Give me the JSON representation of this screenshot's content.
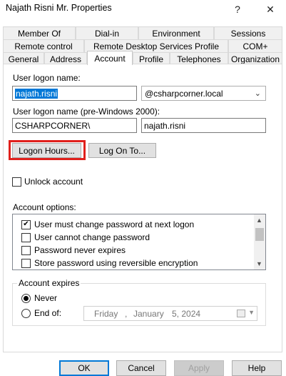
{
  "window": {
    "title": "Najath Risni Mr. Properties",
    "help_glyph": "?",
    "close_glyph": "✕"
  },
  "tabs": {
    "row1": [
      "Member Of",
      "Dial-in",
      "Environment",
      "Sessions"
    ],
    "row2": [
      "Remote control",
      "Remote Desktop Services Profile",
      "COM+"
    ],
    "row3": [
      "General",
      "Address",
      "Account",
      "Profile",
      "Telephones",
      "Organization"
    ],
    "active": "Account"
  },
  "account": {
    "logon_name_label": "User logon name:",
    "logon_name_value": "najath.risni",
    "domain_value": "@csharpcorner.local",
    "pre2000_label": "User logon name (pre-Windows 2000):",
    "pre2000_domain": "CSHARPCORNER\\",
    "pre2000_user": "najath.risni",
    "logon_hours_button": "Logon Hours...",
    "log_on_to_button": "Log On To...",
    "unlock_label": "Unlock account",
    "unlock_checked": false,
    "options_label": "Account options:",
    "options": [
      {
        "label": "User must change password at next logon",
        "checked": true
      },
      {
        "label": "User cannot change password",
        "checked": false
      },
      {
        "label": "Password never expires",
        "checked": false
      },
      {
        "label": "Store password using reversible encryption",
        "checked": false
      }
    ],
    "expires_legend": "Account expires",
    "never_label": "Never",
    "end_of_label": "End of:",
    "expiry_selected": "Never",
    "date": {
      "weekday": "Friday",
      "sep": ",",
      "month": "January",
      "day": "5, 2024"
    }
  },
  "buttons": {
    "ok": "OK",
    "cancel": "Cancel",
    "apply": "Apply",
    "help": "Help"
  },
  "colors": {
    "highlight": "#e0201c",
    "selection": "#0078d7"
  }
}
